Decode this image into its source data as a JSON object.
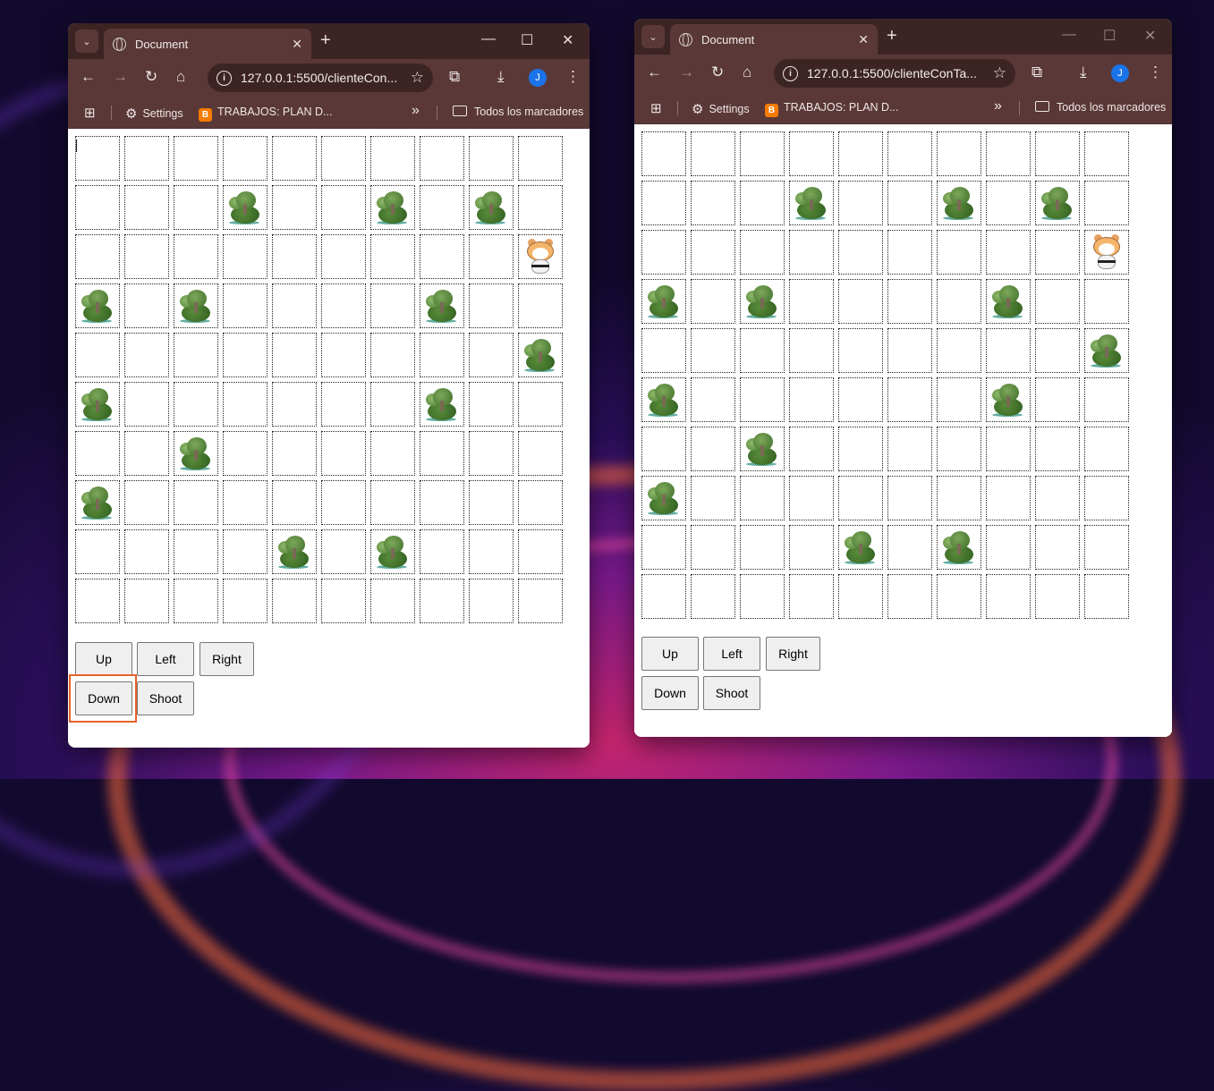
{
  "windows": [
    {
      "tab_title": "Document",
      "url": "127.0.0.1:5500/clienteCon...",
      "bookmarks": {
        "settings": "Settings",
        "blog": "TRABAJOS: PLAN D...",
        "overflow": "»",
        "all": "Todos los marcadores"
      },
      "profile_initial": "J",
      "trees": [
        [
          1,
          3
        ],
        [
          1,
          6
        ],
        [
          1,
          8
        ],
        [
          3,
          0
        ],
        [
          3,
          2
        ],
        [
          3,
          7
        ],
        [
          4,
          9
        ],
        [
          5,
          0
        ],
        [
          5,
          7
        ],
        [
          6,
          2
        ],
        [
          7,
          0
        ],
        [
          8,
          4
        ],
        [
          8,
          6
        ]
      ],
      "player": [
        2,
        9
      ],
      "buttons": {
        "up": "Up",
        "left": "Left",
        "right": "Right",
        "down": "Down",
        "shoot": "Shoot"
      },
      "highlighted_button": "Down"
    },
    {
      "tab_title": "Document",
      "url": "127.0.0.1:5500/clienteConTa...",
      "bookmarks": {
        "settings": "Settings",
        "blog": "TRABAJOS: PLAN D...",
        "overflow": "»",
        "all": "Todos los marcadores"
      },
      "profile_initial": "J",
      "trees": [
        [
          1,
          3
        ],
        [
          1,
          6
        ],
        [
          1,
          8
        ],
        [
          3,
          0
        ],
        [
          3,
          2
        ],
        [
          3,
          7
        ],
        [
          4,
          9
        ],
        [
          5,
          0
        ],
        [
          5,
          7
        ],
        [
          6,
          2
        ],
        [
          7,
          0
        ],
        [
          8,
          4
        ],
        [
          8,
          6
        ]
      ],
      "player": [
        2,
        9
      ],
      "buttons": {
        "up": "Up",
        "left": "Left",
        "right": "Right",
        "down": "Down",
        "shoot": "Shoot"
      }
    }
  ]
}
